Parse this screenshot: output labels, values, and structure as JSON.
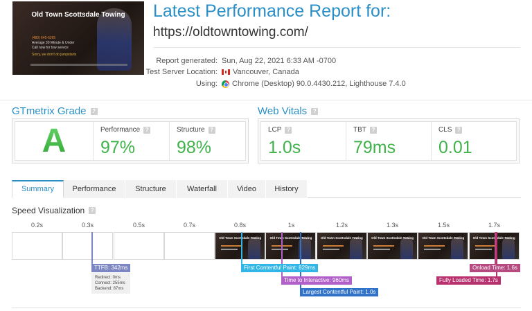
{
  "thumbnail": {
    "title": "Old Town Scottsdale Towing",
    "lines": [
      "(480) 645-6265",
      "Average 30 Minute & Under",
      "Call now for tow service",
      "Sorry, we don't do jumpstarts"
    ]
  },
  "header": {
    "title": "Latest Performance Report for:",
    "url": "https://oldtowntowing.com/"
  },
  "report_meta": {
    "generated_label": "Report generated:",
    "generated_value": "Sun, Aug 22, 2021 6:33 AM -0700",
    "location_label": "Test Server Location:",
    "location_value": "Vancouver, Canada",
    "using_label": "Using:",
    "using_value": "Chrome (Desktop) 90.0.4430.212, Lighthouse 7.4.0"
  },
  "grade": {
    "title": "GTmetrix Grade",
    "letter": "A",
    "performance_label": "Performance",
    "performance_value": "97%",
    "structure_label": "Structure",
    "structure_value": "98%"
  },
  "vitals": {
    "title": "Web Vitals",
    "lcp_label": "LCP",
    "lcp_value": "1.0s",
    "tbt_label": "TBT",
    "tbt_value": "79ms",
    "cls_label": "CLS",
    "cls_value": "0.01"
  },
  "tabs": [
    "Summary",
    "Performance",
    "Structure",
    "Waterfall",
    "Video",
    "History"
  ],
  "speed_visualization": {
    "title": "Speed Visualization",
    "ticks": [
      "0.2s",
      "0.3s",
      "0.5s",
      "0.7s",
      "0.8s",
      "1s",
      "1.2s",
      "1.3s",
      "1.5s",
      "1.7s"
    ],
    "frame_title": "Old Town Scottsdale Towing",
    "ttfb_label": "TTFB: 342ms",
    "ttfb_details": [
      "Redirect: 0ms",
      "Connect: 255ms",
      "Backend: 87ms"
    ],
    "fcp_label": "First Contentful Paint: 829ms",
    "tti_label": "Time to Interactive: 960ms",
    "lcp_label": "Largest Contentful Paint: 1.0s",
    "onload_label": "Onload Time: 1.6s",
    "fully_loaded_label": "Fully Loaded Time: 1.7s"
  },
  "colors": {
    "accent": "#2a8fc7",
    "grade_green": "#3fb24a",
    "ttfb": "#7b86c2",
    "fcp": "#31b6e8",
    "tti": "#b15fc9",
    "lcp": "#2f72c8",
    "onload": "#b64a80",
    "fully_loaded": "#b8306e"
  }
}
